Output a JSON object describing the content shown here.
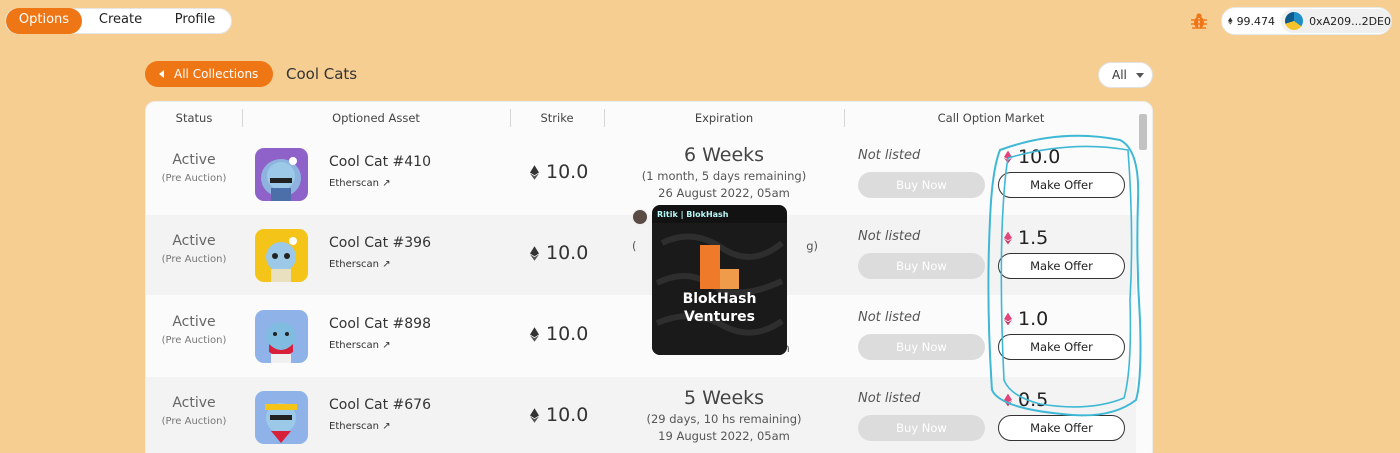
{
  "nav": {
    "tabs": [
      "Options",
      "Create",
      "Profile"
    ],
    "active_tab": "Options"
  },
  "wallet": {
    "balance": "99.474",
    "address": "0xA209...2DE0"
  },
  "header": {
    "back_label": "All Collections",
    "collection_title": "Cool Cats",
    "filter_value": "All"
  },
  "table": {
    "columns": [
      "Status",
      "Optioned Asset",
      "Strike",
      "Expiration",
      "Call Option Market"
    ],
    "rows": [
      {
        "status": "Active",
        "status_sub": "(Pre Auction)",
        "asset_name": "Cool Cat #410",
        "asset_link": "Etherscan",
        "strike": "10.0",
        "exp_main": "6 Weeks",
        "exp_sub": "(1 month, 5 days remaining)",
        "exp_date": "26 August 2022, 05am",
        "market_status": "Not listed",
        "buy_label": "Buy Now",
        "offer_price": "10.0",
        "offer_label": "Make Offer"
      },
      {
        "status": "Active",
        "status_sub": "(Pre Auction)",
        "asset_name": "Cool Cat #396",
        "asset_link": "Etherscan",
        "strike": "10.0",
        "exp_main": "",
        "exp_sub": "(",
        "exp_sub_right": "g)",
        "exp_date": "",
        "market_status": "Not listed",
        "buy_label": "Buy Now",
        "offer_price": "1.5",
        "offer_label": "Make Offer"
      },
      {
        "status": "Active",
        "status_sub": "(Pre Auction)",
        "asset_name": "Cool Cat #898",
        "asset_link": "Etherscan",
        "strike": "10.0",
        "exp_main": "",
        "exp_sub": "",
        "exp_date": "19 August 2022, 05am",
        "market_status": "Not listed",
        "buy_label": "Buy Now",
        "offer_price": "1.0",
        "offer_label": "Make Offer"
      },
      {
        "status": "Active",
        "status_sub": "(Pre Auction)",
        "asset_name": "Cool Cat #676",
        "asset_link": "Etherscan",
        "strike": "10.0",
        "exp_main": "5 Weeks",
        "exp_sub": "(29 days, 10 hs remaining)",
        "exp_date": "19 August 2022, 05am",
        "market_status": "Not listed",
        "buy_label": "Buy Now",
        "offer_price": "0.5",
        "offer_label": "Make Offer"
      }
    ]
  },
  "overlay": {
    "title": "Ritik | BlokHash",
    "brand_line1": "BlokHash",
    "brand_line2": "Ventures"
  },
  "colors": {
    "background": "#f6ce92",
    "accent": "#ee7615",
    "annotation": "#3fb8d6"
  }
}
